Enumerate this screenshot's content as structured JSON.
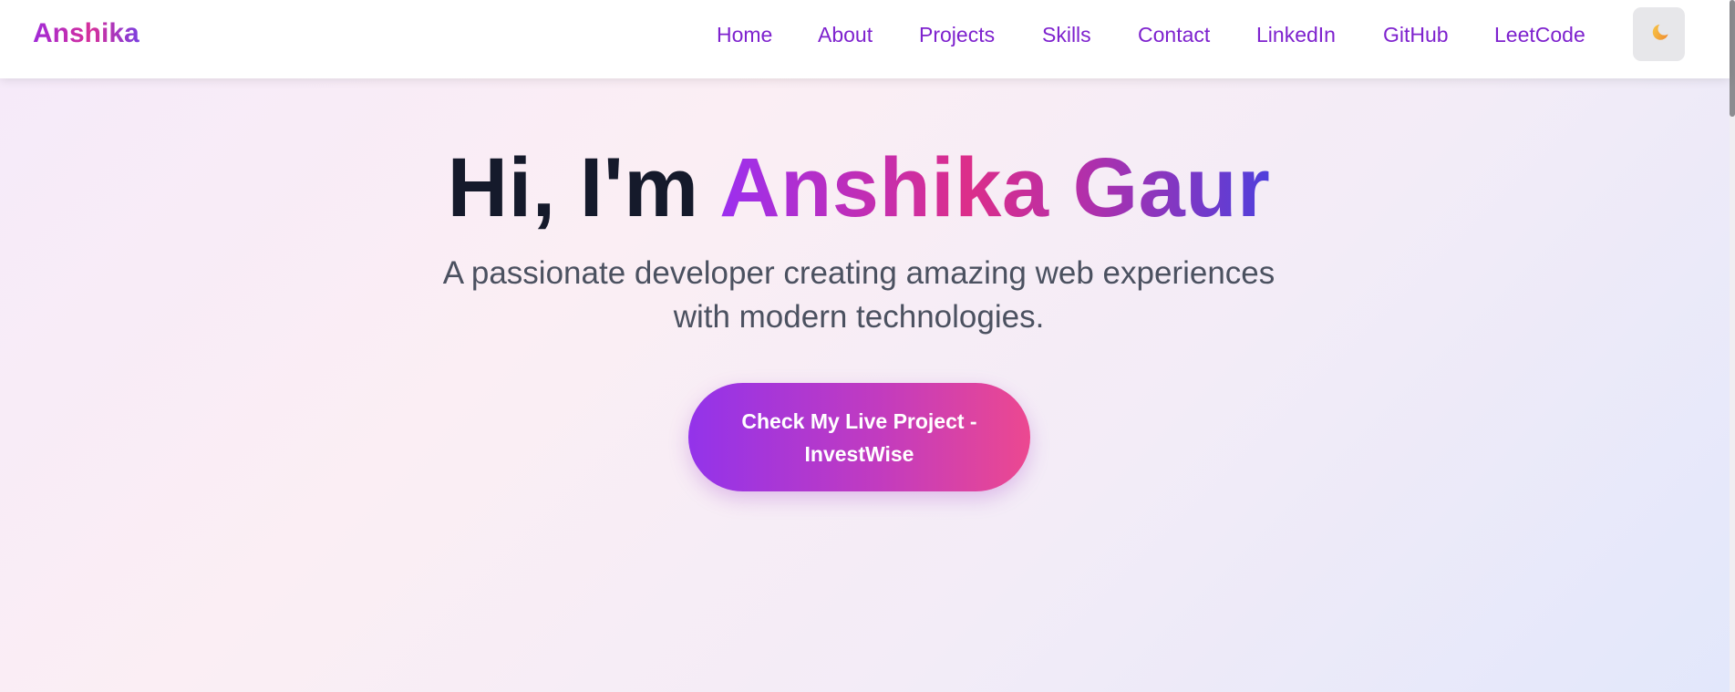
{
  "nav": {
    "brand": "Anshika",
    "links": [
      {
        "label": "Home"
      },
      {
        "label": "About"
      },
      {
        "label": "Projects"
      },
      {
        "label": "Skills"
      },
      {
        "label": "Contact"
      },
      {
        "label": "LinkedIn"
      },
      {
        "label": "GitHub"
      },
      {
        "label": "LeetCode"
      }
    ],
    "theme_toggle_icon": "moon-icon"
  },
  "hero": {
    "greeting": "Hi, I'm ",
    "name": "Anshika Gaur",
    "subtitle_line1": "A passionate developer creating amazing web experiences",
    "subtitle_line2": "with modern technologies.",
    "cta_line1": "Check My Live Project -",
    "cta_line2": "InvestWise"
  },
  "colors": {
    "accent_purple": "#7e22ce",
    "cta_start": "#9333ea",
    "cta_end": "#ec4890",
    "heading_dark": "#151a2b"
  }
}
